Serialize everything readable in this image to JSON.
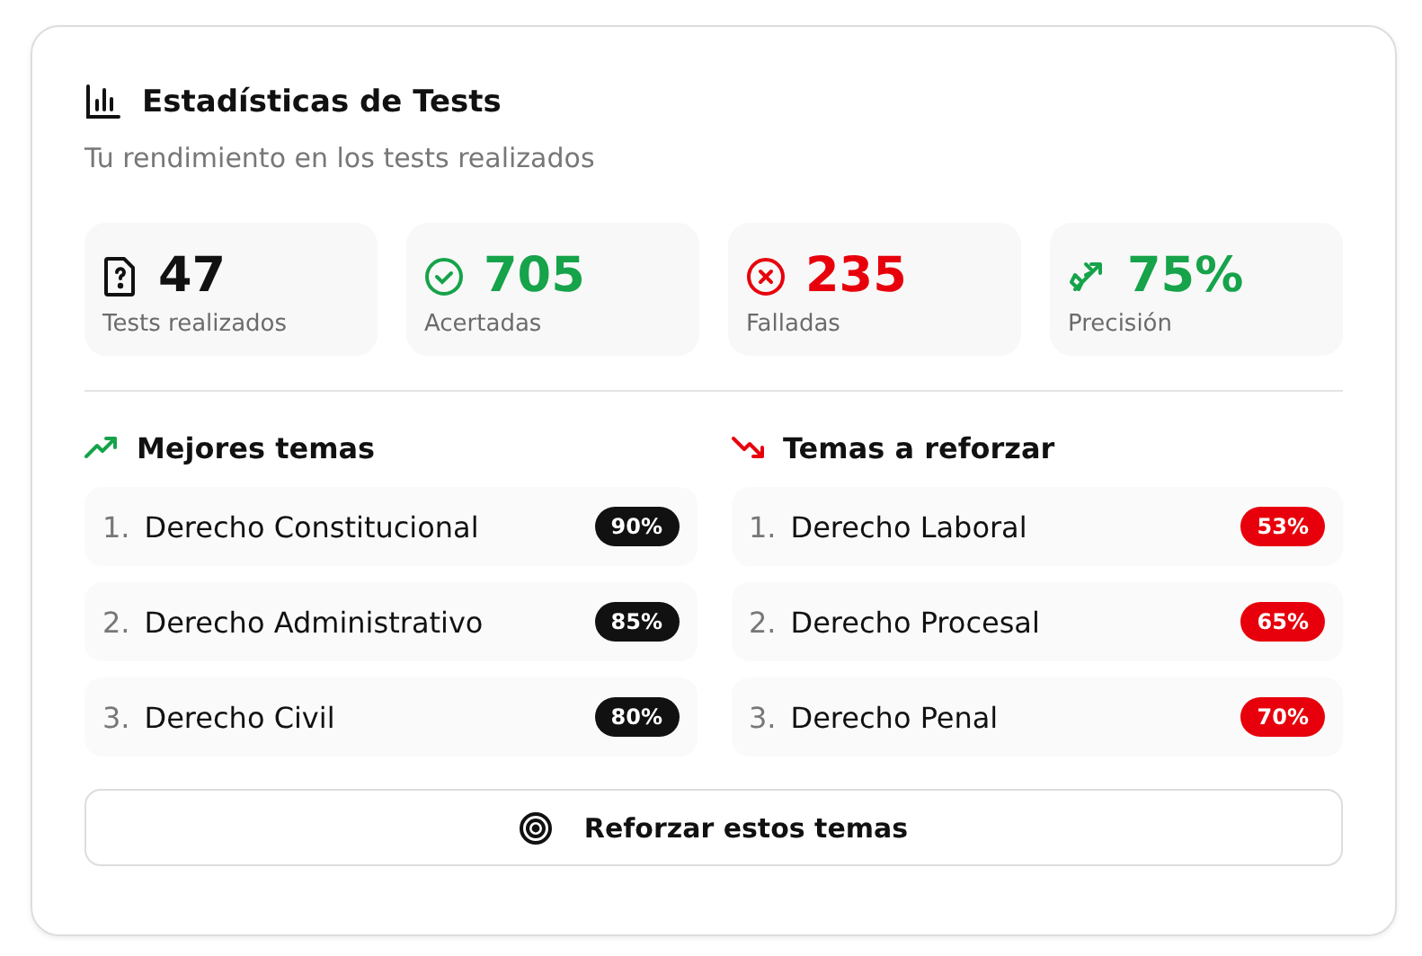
{
  "card": {
    "title": "Estadísticas de Tests",
    "subtitle": "Tu rendimiento en los tests realizados"
  },
  "stats": [
    {
      "kind": "total",
      "value": "47",
      "label": "Tests realizados"
    },
    {
      "kind": "correct",
      "value": "705",
      "label": "Acertadas"
    },
    {
      "kind": "wrong",
      "value": "235",
      "label": "Falladas"
    },
    {
      "kind": "precision",
      "value": "75%",
      "label": "Precisión"
    }
  ],
  "sections": [
    {
      "kind": "best",
      "title": "Mejores temas",
      "topics": [
        {
          "index": "1.",
          "name": "Derecho Constitucional",
          "score": "90%"
        },
        {
          "index": "2.",
          "name": "Derecho Administrativo",
          "score": "85%"
        },
        {
          "index": "3.",
          "name": "Derecho Civil",
          "score": "80%"
        }
      ]
    },
    {
      "kind": "weak",
      "title": "Temas a reforzar",
      "topics": [
        {
          "index": "1.",
          "name": "Derecho Laboral",
          "score": "53%"
        },
        {
          "index": "2.",
          "name": "Derecho Procesal",
          "score": "65%"
        },
        {
          "index": "3.",
          "name": "Derecho Penal",
          "score": "70%"
        }
      ]
    }
  ],
  "button": {
    "label": "Reforzar estos temas"
  }
}
